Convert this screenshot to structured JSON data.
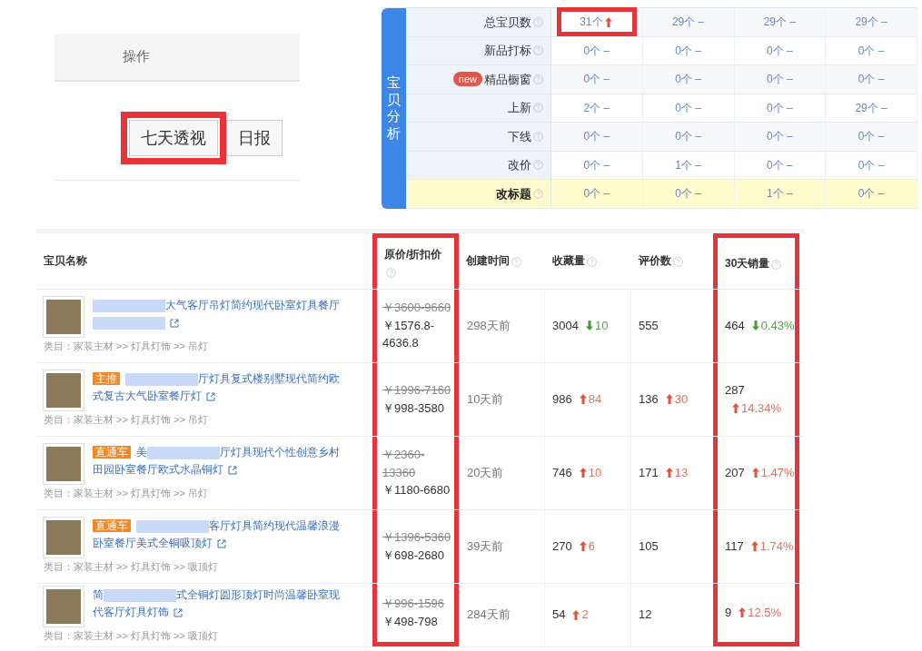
{
  "actions_panel": {
    "header": "操作",
    "buttons": [
      {
        "label": "七天透视",
        "highlighted": true
      },
      {
        "label": "日报",
        "highlighted": false
      }
    ]
  },
  "analysis_panel": {
    "section_label": "宝贝分析",
    "rows": [
      {
        "label": "总宝贝数",
        "emphasis": false,
        "cells": [
          {
            "text": "31个",
            "up_arrow": true,
            "highlighted": true
          },
          {
            "text": "29个 –",
            "up_arrow": false,
            "highlighted": false
          },
          {
            "text": "29个 –",
            "up_arrow": false,
            "highlighted": false
          },
          {
            "text": "29个 –",
            "up_arrow": false,
            "highlighted": false
          }
        ]
      },
      {
        "label": "新品打标",
        "emphasis": false,
        "cells": [
          {
            "text": "0个 –",
            "up_arrow": false,
            "highlighted": false
          },
          {
            "text": "0个 –",
            "up_arrow": false,
            "highlighted": false
          },
          {
            "text": "0个 –",
            "up_arrow": false,
            "highlighted": false
          },
          {
            "text": "0个 –",
            "up_arrow": false,
            "highlighted": false
          }
        ]
      },
      {
        "label": "精品橱窗",
        "badge": "new",
        "emphasis": false,
        "cells": [
          {
            "text": "0个 –",
            "up_arrow": false,
            "highlighted": false
          },
          {
            "text": "0个 –",
            "up_arrow": false,
            "highlighted": false
          },
          {
            "text": "0个 –",
            "up_arrow": false,
            "highlighted": false
          },
          {
            "text": "0个 –",
            "up_arrow": false,
            "highlighted": false
          }
        ]
      },
      {
        "label": "上新",
        "emphasis": false,
        "cells": [
          {
            "text": "2个 –",
            "up_arrow": false,
            "highlighted": false
          },
          {
            "text": "0个 –",
            "up_arrow": false,
            "highlighted": false
          },
          {
            "text": "0个 –",
            "up_arrow": false,
            "highlighted": false
          },
          {
            "text": "29个 –",
            "up_arrow": false,
            "highlighted": false
          }
        ]
      },
      {
        "label": "下线",
        "emphasis": false,
        "cells": [
          {
            "text": "0个 –",
            "up_arrow": false,
            "highlighted": false
          },
          {
            "text": "0个 –",
            "up_arrow": false,
            "highlighted": false
          },
          {
            "text": "0个 –",
            "up_arrow": false,
            "highlighted": false
          },
          {
            "text": "0个 –",
            "up_arrow": false,
            "highlighted": false
          }
        ]
      },
      {
        "label": "改价",
        "emphasis": false,
        "cells": [
          {
            "text": "0个 –",
            "up_arrow": false,
            "highlighted": false
          },
          {
            "text": "1个 –",
            "up_arrow": false,
            "highlighted": false
          },
          {
            "text": "0个 –",
            "up_arrow": false,
            "highlighted": false
          },
          {
            "text": "0个 –",
            "up_arrow": false,
            "highlighted": false
          }
        ]
      },
      {
        "label": "改标题",
        "emphasis": true,
        "cells": [
          {
            "text": "0个 –",
            "up_arrow": false,
            "highlighted": false
          },
          {
            "text": "0个 –",
            "up_arrow": false,
            "highlighted": false
          },
          {
            "text": "1个 –",
            "up_arrow": false,
            "highlighted": false
          },
          {
            "text": "0个 –",
            "up_arrow": false,
            "highlighted": false
          }
        ]
      }
    ]
  },
  "product_table": {
    "columns": [
      {
        "label": "宝贝名称",
        "help": false,
        "highlighted": false
      },
      {
        "label": "原价/折扣价",
        "help": true,
        "highlighted": true
      },
      {
        "label": "创建时间",
        "help": true,
        "highlighted": false
      },
      {
        "label": "收藏量",
        "help": true,
        "highlighted": false
      },
      {
        "label": "评价数",
        "help": true,
        "highlighted": false
      },
      {
        "label": "30天销量",
        "help": true,
        "highlighted": true
      }
    ],
    "rows": [
      {
        "title": [
          {
            "kind": "blur"
          },
          {
            "kind": "text",
            "text": "大气客厅吊灯简约现代卧室灯具餐厅"
          },
          {
            "kind": "blur"
          }
        ],
        "category": "类目：家装主材 >> 灯具灯饰 >> 吊灯",
        "original_price": "￥3600-9660",
        "discount_price": "￥1576.8-4636.8",
        "created": "298天前",
        "favorites": {
          "value": "3004",
          "rising": false,
          "delta": "10"
        },
        "reviews": {
          "value": "555"
        },
        "sales": {
          "value": "464",
          "rising": false,
          "delta": "0.43%"
        }
      },
      {
        "tag": "主推",
        "title": [
          {
            "kind": "blur"
          },
          {
            "kind": "text",
            "text": "厅灯具复式楼别墅现代简约欧式复古大气卧室餐厅灯"
          }
        ],
        "category": "类目：家装主材 >> 灯具灯饰 >> 吊灯",
        "original_price": "￥1996-7160",
        "discount_price": "￥998-3580",
        "created": "10天前",
        "favorites": {
          "value": "986",
          "rising": true,
          "delta": "84"
        },
        "reviews": {
          "value": "136",
          "rising": true,
          "delta": "30"
        },
        "sales": {
          "value": "287",
          "rising": true,
          "delta": "14.34%"
        }
      },
      {
        "tag": "直通车",
        "title": [
          {
            "kind": "text",
            "text": "美"
          },
          {
            "kind": "blur"
          },
          {
            "kind": "text",
            "text": "厅灯具现代个性创意乡村田园卧室餐厅欧式水晶铜灯"
          }
        ],
        "category": "类目：家装主材 >> 灯具灯饰 >> 吊灯",
        "original_price": "￥2360-13360",
        "discount_price": "￥1180-6680",
        "created": "20天前",
        "favorites": {
          "value": "746",
          "rising": true,
          "delta": "10"
        },
        "reviews": {
          "value": "171",
          "rising": true,
          "delta": "13"
        },
        "sales": {
          "value": "207",
          "rising": true,
          "delta": "1.47%"
        }
      },
      {
        "tag": "直通车",
        "title": [
          {
            "kind": "blur"
          },
          {
            "kind": "text",
            "text": "客厅灯具简约现代温馨浪漫卧室餐厅美式全铜吸顶灯"
          }
        ],
        "category": "类目：家装主材 >> 灯具灯饰 >> 吸顶灯",
        "original_price": "￥1396-5360",
        "discount_price": "￥698-2680",
        "created": "39天前",
        "favorites": {
          "value": "270",
          "rising": true,
          "delta": "6"
        },
        "reviews": {
          "value": "105"
        },
        "sales": {
          "value": "117",
          "rising": true,
          "delta": "1.74%"
        }
      },
      {
        "title": [
          {
            "kind": "text",
            "text": "简"
          },
          {
            "kind": "blur"
          },
          {
            "kind": "text",
            "text": "式全铜灯圆形顶灯时尚温馨卧室现代客厅灯具灯饰"
          }
        ],
        "category": "类目：家装主材 >> 灯具灯饰 >> 吸顶灯",
        "original_price": "￥996-1596",
        "discount_price": "￥498-798",
        "created": "284天前",
        "favorites": {
          "value": "54",
          "rising": true,
          "delta": "2"
        },
        "reviews": {
          "value": "12"
        },
        "sales": {
          "value": "9",
          "rising": true,
          "delta": "12.5%"
        }
      }
    ]
  }
}
